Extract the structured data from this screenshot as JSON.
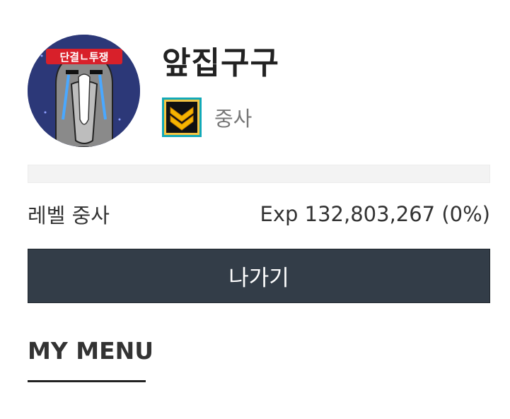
{
  "profile": {
    "nickname": "앞집구구",
    "avatar_banner_text": "단결ㄴ투쟁",
    "rank_icon": "sergeant-chevron-icon",
    "rank_name": "중사"
  },
  "level": {
    "label": "레벨 중사",
    "exp_text": "Exp 132,803,267 (0%)",
    "progress_percent": 0
  },
  "actions": {
    "exit_label": "나가기"
  },
  "menu": {
    "title": "MY MENU"
  },
  "colors": {
    "button_bg": "#333d48",
    "badge_gold": "#f6b400",
    "badge_frame": "#12a9b8"
  }
}
